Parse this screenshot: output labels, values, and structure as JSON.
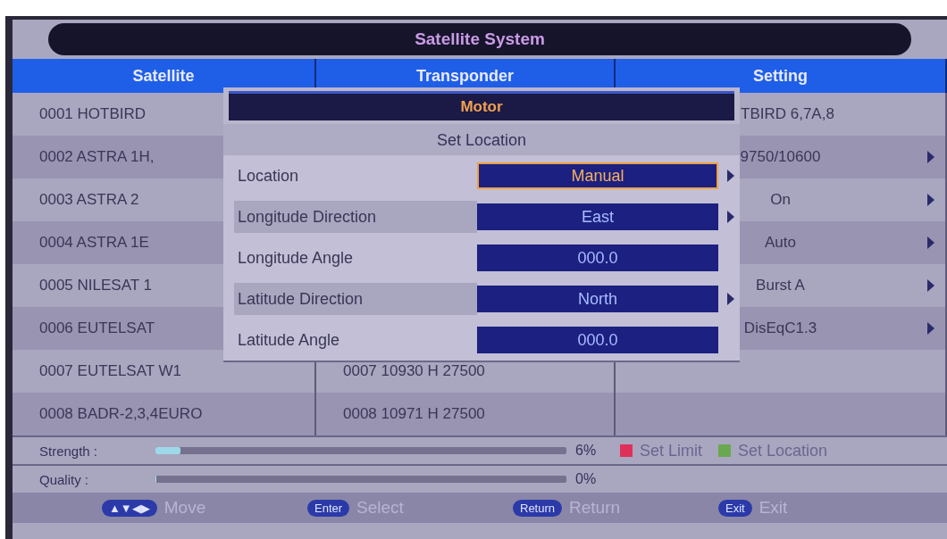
{
  "window": {
    "title": "Satellite System"
  },
  "table": {
    "columns": [
      "Satellite",
      "Transponder",
      "Setting"
    ],
    "rows": [
      {
        "satellite": "0001  HOTBIRD",
        "setting": "TBIRD 6,7A,8",
        "arrow": false
      },
      {
        "satellite": "0002 ASTRA 1H,",
        "setting": "9750/10600",
        "arrow": true
      },
      {
        "satellite": "0003  ASTRA 2",
        "setting": "On",
        "arrow": true
      },
      {
        "satellite": "0004  ASTRA 1E",
        "setting": "Auto",
        "arrow": true
      },
      {
        "satellite": "0005  NILESAT 1",
        "setting": "Burst A",
        "arrow": true
      },
      {
        "satellite": "0006  EUTELSAT",
        "setting": "DisEqC1.3",
        "arrow": true
      },
      {
        "satellite": "0007   EUTELSAT W1",
        "transponder": "0007   10930 H 27500"
      },
      {
        "satellite": "0008  BADR-2,3,4EURO",
        "transponder": "0008   10971 H 27500"
      }
    ]
  },
  "dialog": {
    "title": "Motor",
    "subtitle": "Set Location",
    "rows": [
      {
        "label": "Location",
        "value": "Manual",
        "kind": "option",
        "selected": true
      },
      {
        "label": "Longitude Direction",
        "value": "East",
        "kind": "option",
        "selected": false
      },
      {
        "label": "Longitude Angle",
        "value": "000.0",
        "kind": "input",
        "selected": false
      },
      {
        "label": "Latitude Direction",
        "value": "North",
        "kind": "option",
        "selected": false
      },
      {
        "label": "Latitude Angle",
        "value": "000.0",
        "kind": "input",
        "selected": false
      }
    ]
  },
  "signal": [
    {
      "label": "Strength :",
      "level": 0.06,
      "reading": "6%"
    },
    {
      "label": "Quality :",
      "level": 0,
      "reading": "0%"
    }
  ],
  "legend": [
    {
      "label": "Set Limit",
      "color": "#e0305a"
    },
    {
      "label": "Set Location",
      "color": "#6aa84f"
    }
  ],
  "footer": [
    {
      "key": "▲▼◀▶",
      "action": "Move"
    },
    {
      "key": "Enter",
      "action": "Select"
    },
    {
      "key": "Return",
      "action": "Return"
    },
    {
      "key": "Exit",
      "action": "Exit"
    }
  ]
}
